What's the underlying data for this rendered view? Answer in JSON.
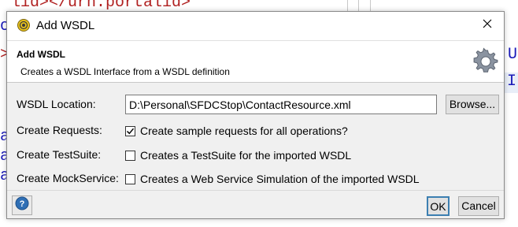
{
  "background": {
    "top_fragment_tag1": "lid>",
    "top_fragment_mid": "</urn.portalid>",
    "left_fragments": [
      "o",
      ">",
      "a",
      "a",
      "a"
    ],
    "right_fragments": [
      "U",
      "I"
    ]
  },
  "dialog": {
    "title": "Add WSDL",
    "close_glyph": "✕",
    "header": {
      "title": "Add WSDL",
      "description": "Creates a WSDL Interface from a WSDL definition"
    },
    "fields": {
      "wsdl_location": {
        "label": "WSDL Location:",
        "value": "D:\\Personal\\SFDCStop\\ContactResource.xml",
        "browse_label": "Browse..."
      },
      "create_requests": {
        "label": "Create Requests:",
        "checkbox_label": "Create sample requests for all operations?",
        "checked": true
      },
      "create_testsuite": {
        "label": "Create TestSuite:",
        "checkbox_label": "Creates a TestSuite for the imported WSDL",
        "checked": false
      },
      "create_mockservice": {
        "label": "Create MockService:",
        "checkbox_label": "Creates a Web Service Simulation of the imported WSDL",
        "checked": false
      }
    },
    "footer": {
      "help_glyph": "?",
      "ok_label": "OK",
      "cancel_label": "Cancel"
    }
  },
  "colors": {
    "accent": "#3c7fb1",
    "help_icon": "#2f6fb5",
    "xml_tag": "#b02020",
    "xml_text": "#1a1ab8"
  }
}
